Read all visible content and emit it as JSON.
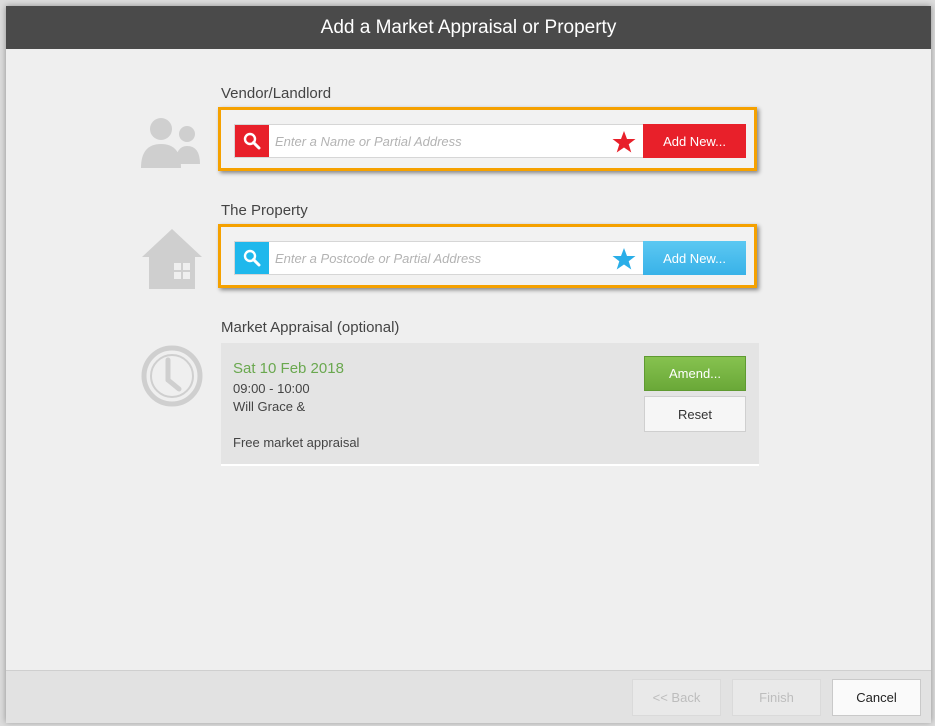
{
  "dialog": {
    "title": "Add a Market Appraisal or Property"
  },
  "vendor": {
    "label": "Vendor/Landlord",
    "placeholder": "Enter a Name or Partial Address",
    "value": "",
    "add_label": "Add New...",
    "accent": "#e8202a"
  },
  "property": {
    "label": "The Property",
    "placeholder": "Enter a Postcode or Partial Address",
    "value": "",
    "add_label": "Add New...",
    "accent": "#1fb8ec"
  },
  "appraisal": {
    "label": "Market Appraisal (optional)",
    "date": "Sat 10 Feb 2018",
    "time": "09:00 - 10:00",
    "agent": "Will Grace &",
    "description": "Free market appraisal",
    "amend_label": "Amend...",
    "reset_label": "Reset"
  },
  "footer": {
    "back_label": "<< Back",
    "finish_label": "Finish",
    "cancel_label": "Cancel"
  },
  "colors": {
    "highlight_border": "#f5a100",
    "titlebar": "#4a4a4a",
    "date_text": "#6aa84f"
  }
}
